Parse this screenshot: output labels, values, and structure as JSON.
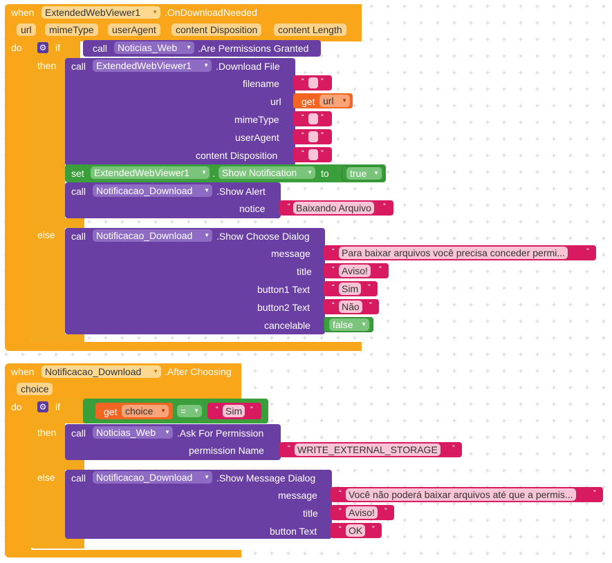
{
  "block1": {
    "when": "when",
    "component": "ExtendedWebViewer1",
    "event": ".OnDownloadNeeded",
    "params": [
      "url",
      "mimeType",
      "userAgent",
      "content Disposition",
      "content Length"
    ],
    "do": "do",
    "if": "if",
    "then": "then",
    "else": "else",
    "cond": {
      "call": "call",
      "component": "Noticias_Web",
      "method": ".Are Permissions Granted"
    },
    "download": {
      "call": "call",
      "component": "ExtendedWebViewer1",
      "method": ".Download File",
      "args": [
        "filename",
        "url",
        "mimeType",
        "userAgent",
        "content Disposition"
      ],
      "url_get": "get",
      "url_var": "url"
    },
    "setblock": {
      "set": "set",
      "component": "ExtendedWebViewer1",
      "dot": ".",
      "prop": "Show Notification",
      "to": "to",
      "value": "true"
    },
    "alert": {
      "call": "call",
      "component": "Notificacao_Download",
      "method": ".Show Alert",
      "arg": "notice",
      "value": "Baixando Arquivo"
    },
    "choose": {
      "call": "call",
      "component": "Notificacao_Download",
      "method": ".Show Choose Dialog",
      "args": [
        "message",
        "title",
        "button1 Text",
        "button2 Text",
        "cancelable"
      ],
      "message": "Para baixar arquivos você precisa conceder permi...",
      "title": "Aviso!",
      "button1": "Sim",
      "button2": "Não",
      "cancelable": "false"
    }
  },
  "block2": {
    "when": "when",
    "component": "Notificacao_Download",
    "event": ".After Choosing",
    "param": "choice",
    "do": "do",
    "if": "if",
    "then": "then",
    "else": "else",
    "cond": {
      "get": "get",
      "var": "choice",
      "op": "=",
      "value": "Sim"
    },
    "ask": {
      "call": "call",
      "component": "Noticias_Web",
      "method": ".Ask For Permission",
      "arg": "permission Name",
      "value": "WRITE_EXTERNAL_STORAGE"
    },
    "msg": {
      "call": "call",
      "component": "Notificacao_Download",
      "method": ".Show Message Dialog",
      "args": [
        "message",
        "title",
        "button Text"
      ],
      "message": "Você não poderá baixar arquivos até que a permis...",
      "title": "Aviso!",
      "button": "OK"
    }
  },
  "icons": {
    "gear": "gear-icon",
    "dropdown": "dropdown-arrow-icon",
    "quote_open": "“",
    "quote_close": "”"
  }
}
